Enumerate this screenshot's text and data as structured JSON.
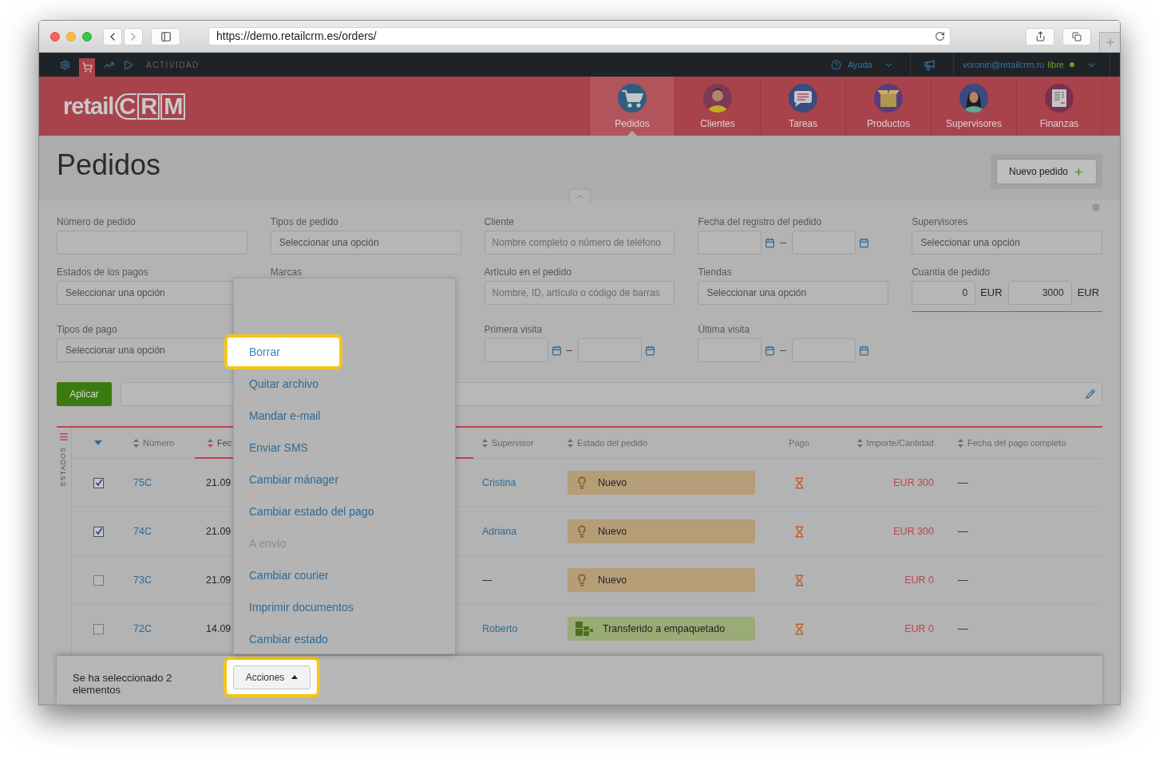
{
  "browser": {
    "url": "https://demo.retailcrm.es/orders/"
  },
  "top_bar": {
    "modules": [
      {
        "kind": "settings",
        "selected": false
      },
      {
        "kind": "orders",
        "selected": true
      },
      {
        "kind": "analytics",
        "selected": false
      },
      {
        "kind": "marketing",
        "selected": false
      }
    ],
    "section": "ACTIVIDAD",
    "help": "Ayuda",
    "user": "voronin@retailcrm.ru",
    "plan": "libre"
  },
  "header": {
    "logo": {
      "word": "retail",
      "letters": [
        "C",
        "R",
        "M"
      ]
    },
    "nav": [
      {
        "kind": "orders",
        "label": "Pedidos",
        "selected": true
      },
      {
        "kind": "customers",
        "label": "Clientes",
        "selected": false
      },
      {
        "kind": "tasks",
        "label": "Tareas",
        "selected": false
      },
      {
        "kind": "products",
        "label": "Productos",
        "selected": false
      },
      {
        "kind": "managers",
        "label": "Supervisores",
        "selected": false
      },
      {
        "kind": "finance",
        "label": "Finanzas",
        "selected": false
      }
    ]
  },
  "page": {
    "title": "Pedidos",
    "new_button": "Nuevo pedido"
  },
  "filters": {
    "rows": [
      [
        {
          "kind": "text",
          "label": "Número de pedido"
        },
        {
          "kind": "select",
          "label": "Tipos de pedido",
          "value": "Seleccionar una opción"
        },
        {
          "kind": "text",
          "label": "Cliente",
          "placeholder": "Nombre completo o número de teléfono"
        },
        {
          "kind": "date_range",
          "label": "Fecha del registro del pedido",
          "separator": "–"
        },
        {
          "kind": "select",
          "label": "Supervisores",
          "value": "Seleccionar una opción"
        }
      ],
      [
        {
          "kind": "select",
          "label": "Estados de los pagos",
          "value": "Seleccionar una opción"
        },
        {
          "kind": "covered",
          "label": "Marcas"
        },
        {
          "kind": "text",
          "label": "Artículo en el pedido",
          "placeholder": "Nombre, ID, artículo o código de barras"
        },
        {
          "kind": "select",
          "label": "Tiendas",
          "value": "Seleccionar una opción"
        },
        {
          "kind": "amount_range",
          "label": "Cuantía de pedido",
          "from": "0",
          "from_currency": "EUR",
          "to": "3000",
          "to_currency": "EUR"
        }
      ],
      [
        {
          "kind": "select",
          "label": "Tipos de pago",
          "value": "Seleccionar una opción"
        },
        {
          "kind": "covered"
        },
        {
          "kind": "date_range",
          "label": "Primera visita",
          "separator": "–"
        },
        {
          "kind": "date_range",
          "label": "Última visita",
          "separator": "–"
        }
      ]
    ],
    "apply_button": "Aplicar"
  },
  "table": {
    "side_label": "ESTADOS",
    "columns": [
      {
        "label": "Número",
        "sortable": true,
        "sorted": false
      },
      {
        "label": "Fec",
        "sortable": true,
        "sorted": true
      },
      {
        "label": "Supervisor",
        "sortable": true,
        "sorted": false
      },
      {
        "label": "Estado del pedido",
        "sortable": true,
        "sorted": false
      },
      {
        "label": "Pago",
        "sortable": false,
        "sorted": false
      },
      {
        "label": "Importe/Cantidad",
        "sortable": true,
        "sorted": false
      },
      {
        "label": "Fecha del pago completo",
        "sortable": true,
        "sorted": false
      }
    ],
    "rows": [
      {
        "selected": true,
        "number": "75C",
        "date": "21.09",
        "supervisor": "Cristina",
        "supervisor_link": true,
        "status": {
          "kind": "new",
          "label": "Nuevo"
        },
        "amount": "EUR 300",
        "payment_date": "—"
      },
      {
        "selected": true,
        "number": "74C",
        "date": "21.09",
        "supervisor": "Adriana",
        "supervisor_link": true,
        "status": {
          "kind": "new",
          "label": "Nuevo"
        },
        "amount": "EUR 300",
        "payment_date": "—"
      },
      {
        "selected": false,
        "number": "73C",
        "date": "21.09",
        "supervisor": "—",
        "supervisor_link": false,
        "status": {
          "kind": "new",
          "label": "Nuevo"
        },
        "amount": "EUR 0",
        "payment_date": "—"
      },
      {
        "selected": false,
        "number": "72C",
        "date": "14.09",
        "supervisor": "Roberto",
        "supervisor_link": true,
        "status": {
          "kind": "packing",
          "label": "Transferido a empaquetado"
        },
        "amount": "EUR 0",
        "payment_date": "—"
      }
    ]
  },
  "bottom_bar": {
    "selection_text": "Se ha seleccionado 2 elementos",
    "actions_button": {
      "label": "Acciones",
      "expanded": true,
      "highlighted": true
    }
  },
  "actions_menu": {
    "items": [
      {
        "label": "Borrar",
        "highlighted": true,
        "disabled": false
      },
      {
        "label": "Quitar archivo",
        "highlighted": false,
        "disabled": false
      },
      {
        "label": "Mandar e-mail",
        "highlighted": false,
        "disabled": false
      },
      {
        "label": "Enviar SMS",
        "highlighted": false,
        "disabled": false
      },
      {
        "label": "Cambiar mánager",
        "highlighted": false,
        "disabled": false
      },
      {
        "label": "Cambiar estado del pago",
        "highlighted": false,
        "disabled": false
      },
      {
        "label": "A envío",
        "highlighted": false,
        "disabled": true
      },
      {
        "label": "Cambiar courier",
        "highlighted": false,
        "disabled": false
      },
      {
        "label": "Imprimir documentos",
        "highlighted": false,
        "disabled": false
      },
      {
        "label": "Cambiar estado",
        "highlighted": false,
        "disabled": false
      }
    ]
  }
}
